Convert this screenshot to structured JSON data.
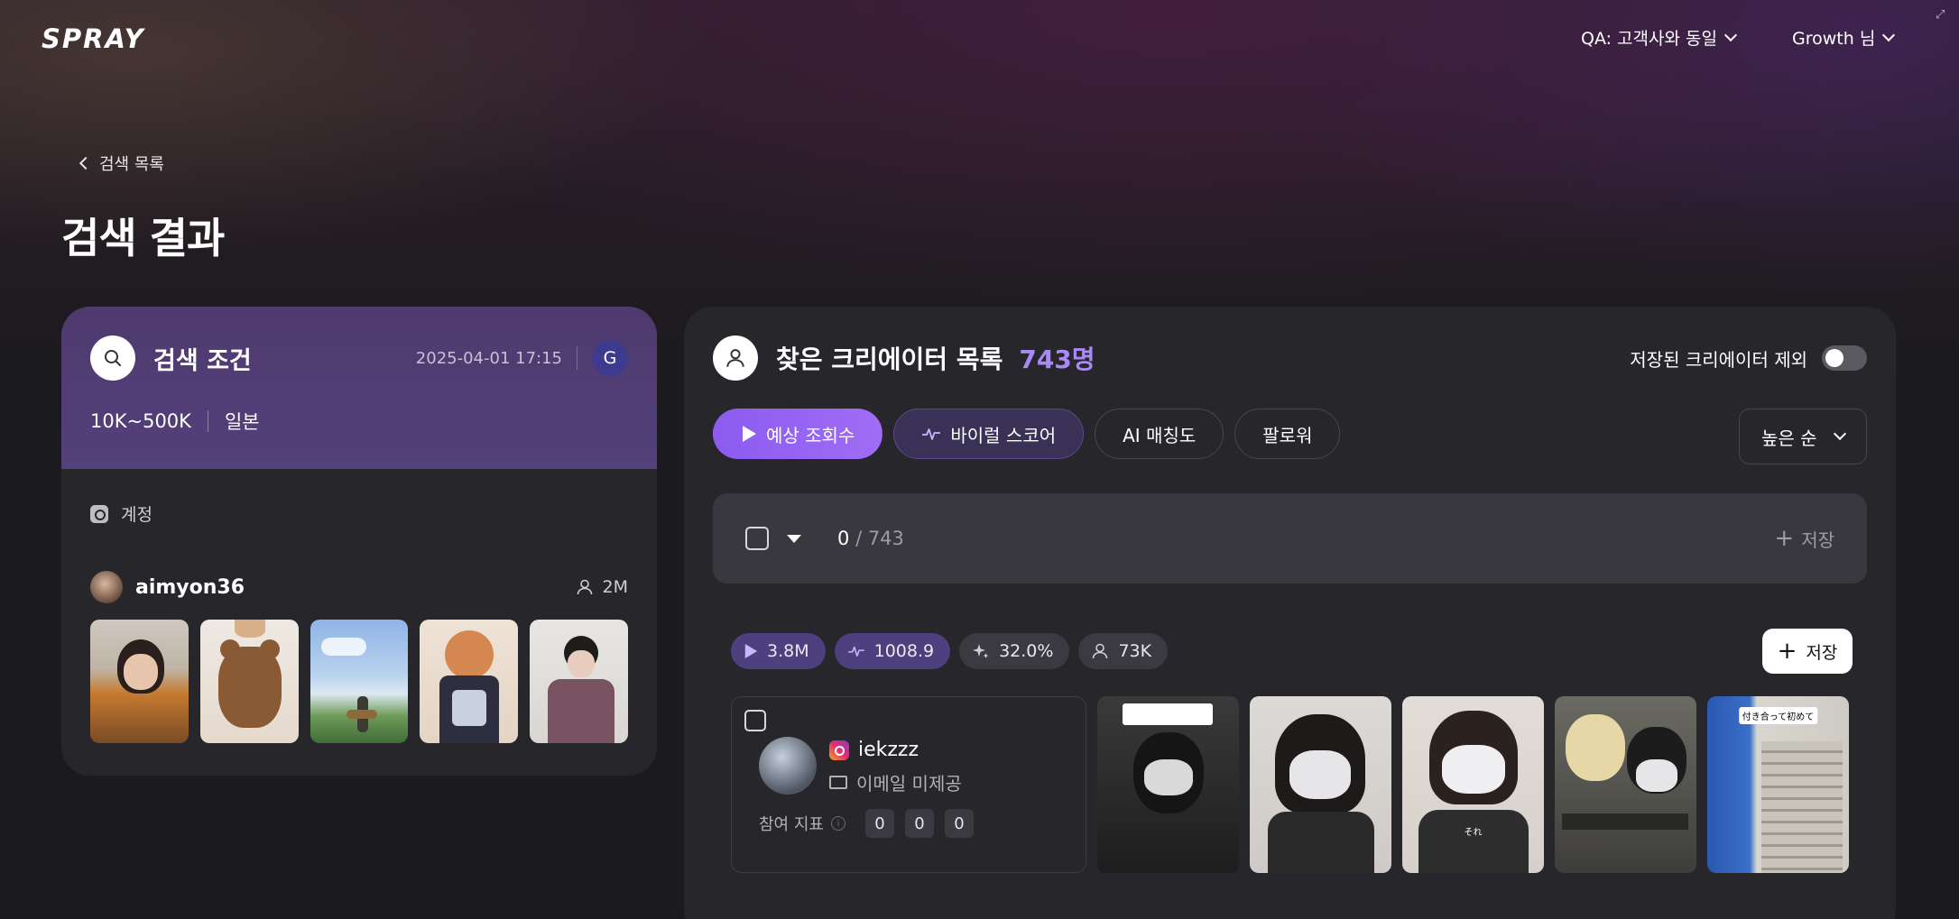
{
  "header": {
    "logo": "SPRAY",
    "workspace": "QA: 고객사와 동일",
    "user": "Growth 님"
  },
  "nav": {
    "back_label": "검색 목록"
  },
  "page": {
    "title": "검색 결과"
  },
  "search_panel": {
    "title": "검색 조건",
    "date": "2025-04-01 17:15",
    "badge": "G",
    "tags": [
      "10K~500K",
      "일본"
    ],
    "account_label": "계정",
    "account": {
      "name": "aimyon36",
      "followers": "2M"
    },
    "thumbnail_count": 5
  },
  "results": {
    "title": "찾은 크리에이터 목록",
    "count": "743명",
    "exclude_saved_label": "저장된 크리에이터 제외",
    "exclude_saved_on": false,
    "tabs": [
      {
        "label": "예상 조회수",
        "icon": "play-icon",
        "state": "active"
      },
      {
        "label": "바이럴 스코어",
        "icon": "pulse-icon",
        "state": "secondary"
      },
      {
        "label": "AI 매칭도",
        "icon": "",
        "state": "default"
      },
      {
        "label": "팔로워",
        "icon": "",
        "state": "default"
      }
    ],
    "sort": "높은 순",
    "selection": {
      "selected": "0",
      "total": "/ 743",
      "save_label": "저장"
    }
  },
  "creator": {
    "stats": [
      {
        "icon": "play-icon",
        "value": "3.8M"
      },
      {
        "icon": "pulse-icon",
        "value": "1008.9"
      },
      {
        "icon": "sparkle-icon",
        "value": "32.0%"
      },
      {
        "icon": "user-icon",
        "value": "73K"
      }
    ],
    "save_label": "저장",
    "handle": "iekzzz",
    "email_status": "이메일 미제공",
    "engagement_label": "참여 지표",
    "engagement_values": [
      "0",
      "0",
      "0"
    ],
    "video_captions": [
      "",
      "",
      "それ",
      "",
      "付き合って初めて"
    ]
  },
  "colors": {
    "accent": "#9b6cf3",
    "count_highlight": "#a889f5",
    "card_bg": "#26262b",
    "search_header_bg": "#52407a"
  }
}
